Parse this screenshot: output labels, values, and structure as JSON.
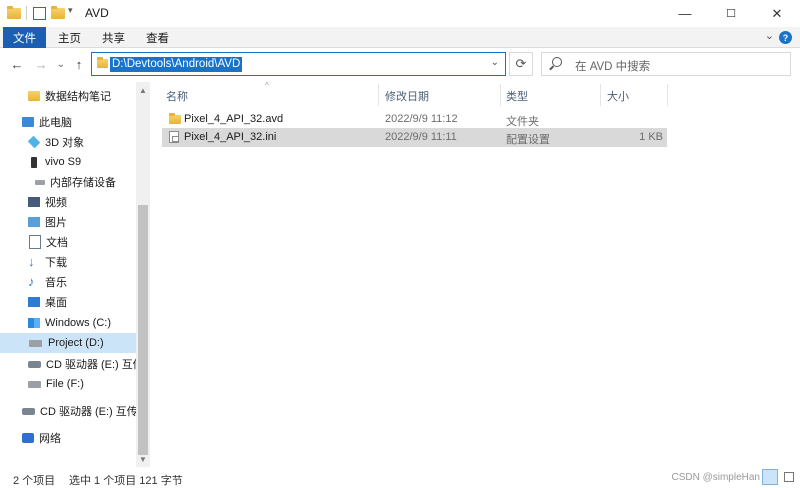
{
  "window": {
    "title": "AVD",
    "min_glyph": "—",
    "max_glyph": "☐",
    "close_glyph": "✕"
  },
  "ribbon": {
    "tabs": [
      "文件",
      "主页",
      "共享",
      "查看"
    ],
    "help_glyph": "?",
    "expand_glyph": "⌄"
  },
  "address": {
    "path": "D:\\Devtools\\Android\\AVD",
    "back_glyph": "←",
    "forward_glyph": "→",
    "recent_glyph": "⌄",
    "up_glyph": "↑",
    "drop_glyph": "⌄",
    "refresh_glyph": "⟳"
  },
  "search": {
    "placeholder": "在 AVD 中搜索"
  },
  "sidebar": {
    "items": [
      {
        "label": "数据结构笔记",
        "icon": "folder-icon"
      },
      {
        "label": "此电脑",
        "icon": "computer-icon"
      },
      {
        "label": "3D 对象",
        "icon": "3d-objects-icon"
      },
      {
        "label": "vivo S9",
        "icon": "phone-icon"
      },
      {
        "label": "内部存储设备",
        "icon": "drive-icon"
      },
      {
        "label": "视频",
        "icon": "video-icon"
      },
      {
        "label": "图片",
        "icon": "pictures-icon"
      },
      {
        "label": "文档",
        "icon": "documents-icon"
      },
      {
        "label": "下载",
        "icon": "download-icon"
      },
      {
        "label": "音乐",
        "icon": "music-icon"
      },
      {
        "label": "桌面",
        "icon": "desktop-icon"
      },
      {
        "label": "Windows (C:)",
        "icon": "windows-drive-icon"
      },
      {
        "label": "Project (D:)",
        "icon": "drive-icon",
        "selected": true
      },
      {
        "label": "CD 驱动器 (E:) 互传",
        "icon": "cd-drive-icon"
      },
      {
        "label": "File (F:)",
        "icon": "drive-icon"
      },
      {
        "label": "CD 驱动器 (E:) 互传",
        "icon": "cd-drive-icon"
      },
      {
        "label": "网络",
        "icon": "network-icon"
      }
    ],
    "scroll_up_glyph": "▲",
    "scroll_down_glyph": "▼"
  },
  "columns": {
    "name": "名称",
    "modified": "修改日期",
    "type": "类型",
    "size": "大小",
    "sort_glyph": "^"
  },
  "files": [
    {
      "name": "Pixel_4_API_32.avd",
      "modified": "2022/9/9 11:12",
      "type": "文件夹",
      "size": "",
      "icon": "folder-icon"
    },
    {
      "name": "Pixel_4_API_32.ini",
      "modified": "2022/9/9 11:11",
      "type": "配置设置",
      "size": "1 KB",
      "icon": "config-file-icon",
      "selected": true
    }
  ],
  "status": {
    "count": "2 个项目",
    "selection": "选中 1 个项目  121 字节",
    "watermark": "CSDN @simpleHan"
  }
}
